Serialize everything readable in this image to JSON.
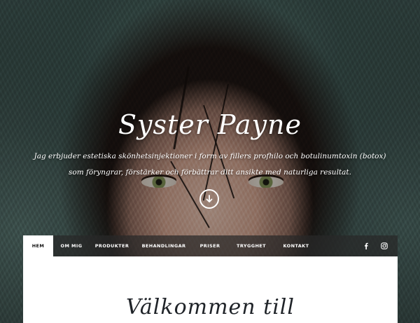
{
  "hero": {
    "title": "Syster Payne",
    "line1": "Jag erbjuder estetiska skönhetsinjektioner i form av fillers profhilo och botulinumtoxin (botox)",
    "line2": "som föryngrar, förstärker och förbättrar ditt ansikte med naturliga resultat.",
    "scroll_icon": "arrow-down-icon"
  },
  "nav": {
    "items": [
      {
        "label": "HEM",
        "active": true
      },
      {
        "label": "OM MIG"
      },
      {
        "label": "PRODUKTER"
      },
      {
        "label": "BEHANDLINGAR"
      },
      {
        "label": "PRISER"
      },
      {
        "label": "TRYGGHET"
      },
      {
        "label": "KONTAKT"
      }
    ],
    "social": [
      "facebook-icon",
      "instagram-icon"
    ]
  },
  "content": {
    "welcome_heading": "Välkommen till"
  },
  "colors": {
    "nav_bg": "#282828",
    "active_bg": "#ffffff",
    "heading": "#1f2328"
  }
}
